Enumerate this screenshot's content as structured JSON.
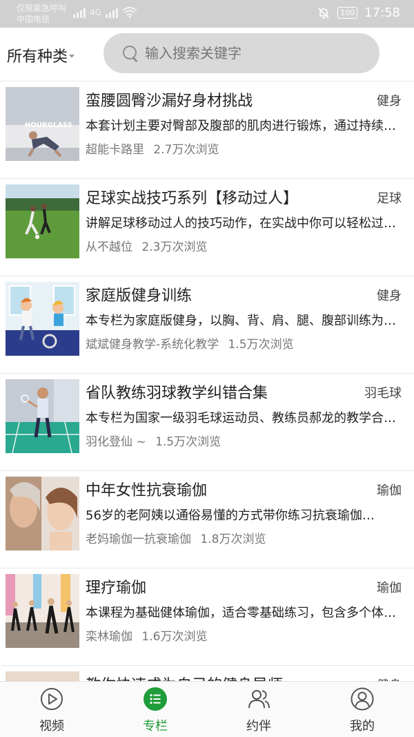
{
  "status_bar": {
    "carrier_line1": "仅限紧急呼叫",
    "carrier_line2": "中国电信",
    "network": "4G",
    "battery": "100",
    "time": "17:58"
  },
  "header": {
    "category_label": "所有种类",
    "search_placeholder": "输入搜索关键字"
  },
  "items": [
    {
      "title": "蛮腰圆臀沙漏好身材挑战",
      "tag": "健身",
      "desc": "本套计划主要对臀部及腹部的肌肉进行锻炼，通过持续训练…",
      "author": "超能卡路里",
      "views": "2.7万次浏览",
      "thumb_text": "HOURGLASS"
    },
    {
      "title": "足球实战技巧系列【移动过人】",
      "tag": "足球",
      "desc": "讲解足球移动过人的技巧动作，在实战中你可以轻松过人…",
      "author": "从不越位",
      "views": "2.3万次浏览"
    },
    {
      "title": "家庭版健身训练",
      "tag": "健身",
      "desc": "本专栏为家庭版健身，以胸、背、肩、腿、腹部训练为主…",
      "author": "斌斌健身教学-系统化教学",
      "views": "1.5万次浏览"
    },
    {
      "title": "省队教练羽球教学纠错合集",
      "tag": "羽毛球",
      "desc": "本专栏为国家一级羽毛球运动员、教练员郝龙的教学合集…",
      "author": "羽化登仙 ~",
      "views": "1.5万次浏览"
    },
    {
      "title": "中年女性抗衰瑜伽",
      "tag": "瑜伽",
      "desc": "56岁的老阿姨以通俗易懂的方式带你练习抗衰瑜伽…",
      "author": "老妈瑜伽一抗衰瑜伽",
      "views": "1.8万次浏览"
    },
    {
      "title": "理疗瑜伽",
      "tag": "瑜伽",
      "desc": "本课程为基础健体瑜伽，适合零基础练习，包含多个体式…",
      "author": "栾林瑜伽",
      "views": "1.6万次浏览"
    },
    {
      "title": "教你快速成为自己的健身导师",
      "tag": "健身",
      "desc": "",
      "author": "",
      "views": ""
    }
  ],
  "bottom_nav": [
    {
      "label": "视频",
      "icon": "play-circle-icon",
      "active": false
    },
    {
      "label": "专栏",
      "icon": "list-icon",
      "active": true
    },
    {
      "label": "约伴",
      "icon": "people-icon",
      "active": false
    },
    {
      "label": "我的",
      "icon": "user-icon",
      "active": false
    }
  ],
  "colors": {
    "accent": "#1f9d3a",
    "status_bar": "#d0d0d0",
    "search_bg": "#d9d9d9"
  }
}
